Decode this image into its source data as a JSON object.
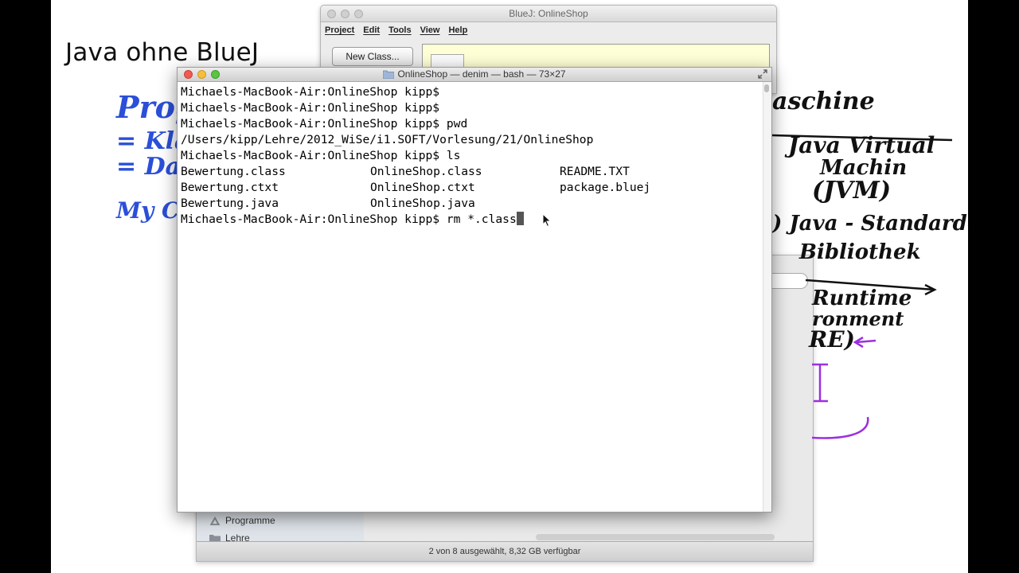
{
  "slide": {
    "title": "Java ohne BlueJ"
  },
  "handwriting_left": {
    "line1": "Progr",
    "line2": "= Kla",
    "line3": "= Da",
    "line4": "My Cla"
  },
  "handwriting_right": {
    "line1": "aschine",
    "line2": "Java Virtual",
    "line3": "Machin",
    "line4": "(JVM)",
    "line5": ") Java - Standard-",
    "line6": "Bibliothek",
    "line7": "Runtime",
    "line8": "ronment",
    "line9": "RE)"
  },
  "bluej": {
    "title": "BlueJ:  OnlineShop",
    "menu": [
      "Project",
      "Edit",
      "Tools",
      "View",
      "Help"
    ],
    "new_class_label": "New Class..."
  },
  "terminal": {
    "title": "OnlineShop — denim — bash — 73×27",
    "lines": [
      "Michaels-MacBook-Air:OnlineShop kipp$",
      "Michaels-MacBook-Air:OnlineShop kipp$",
      "Michaels-MacBook-Air:OnlineShop kipp$ pwd",
      "/Users/kipp/Lehre/2012_WiSe/i1.SOFT/Vorlesung/21/OnlineShop",
      "Michaels-MacBook-Air:OnlineShop kipp$ ls"
    ],
    "ls_rows": [
      [
        "Bewertung.class",
        "OnlineShop.class",
        "README.TXT"
      ],
      [
        "Bewertung.ctxt",
        "OnlineShop.ctxt",
        "package.bluej"
      ],
      [
        "Bewertung.java",
        "OnlineShop.java",
        ""
      ]
    ],
    "current_prompt": "Michaels-MacBook-Air:OnlineShop kipp$ rm *.class"
  },
  "finder": {
    "sidebar_items": [
      "Programme",
      "Lehre"
    ],
    "status": "2 von 8 ausgewählt, 8,32 GB verfügbar"
  },
  "colors": {
    "ink_blue": "#2b4fd8",
    "ink_purple": "#9b30e0",
    "ink_black": "#111111",
    "bluej_canvas": "#ffffd6"
  }
}
